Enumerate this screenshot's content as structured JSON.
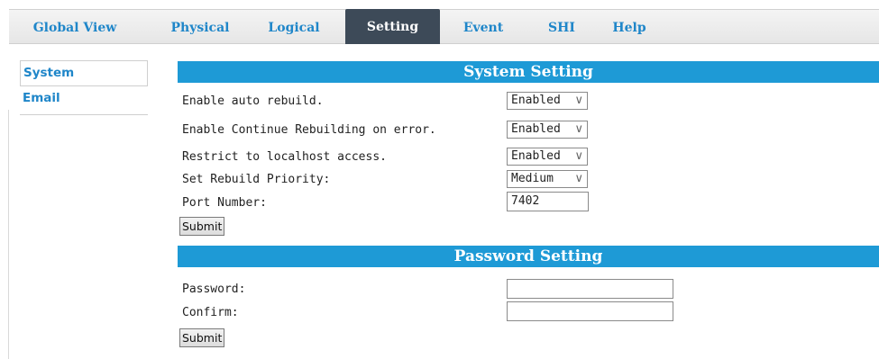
{
  "nav": {
    "tabs": [
      {
        "label": "Global View"
      },
      {
        "label": "Physical"
      },
      {
        "label": "Logical"
      },
      {
        "label": "Setting"
      },
      {
        "label": "Event"
      },
      {
        "label": "SHI"
      },
      {
        "label": "Help"
      }
    ],
    "active_tab": "Setting"
  },
  "sidebar": {
    "items": [
      {
        "label": "System"
      },
      {
        "label": "Email"
      }
    ]
  },
  "system_setting": {
    "title": "System Setting",
    "auto_rebuild": {
      "label": "Enable auto rebuild.",
      "value": "Enabled"
    },
    "continue_rebuild": {
      "label": "Enable Continue Rebuilding on error.",
      "value": "Enabled"
    },
    "localhost": {
      "label": "Restrict to localhost access.",
      "value": "Enabled"
    },
    "priority": {
      "label": "Set Rebuild Priority:",
      "value": "Medium"
    },
    "port": {
      "label": "Port Number:",
      "value": "7402"
    },
    "submit_label": "Submit"
  },
  "password_setting": {
    "title": "Password Setting",
    "password_label": "Password:",
    "confirm_label": "Confirm:",
    "submit_label": "Submit"
  },
  "icons": {
    "dropdown": "chevron-down-icon"
  },
  "colors": {
    "accent": "#1e9ad6",
    "tab_active_bg": "#3d4a58",
    "link": "#1f86c9"
  }
}
